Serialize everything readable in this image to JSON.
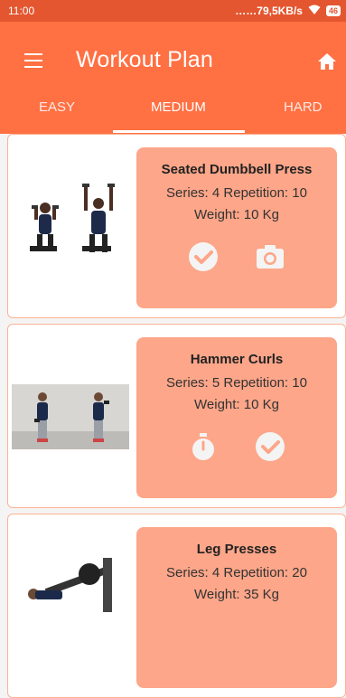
{
  "status": {
    "time": "11:00",
    "network": "……79,5KB/s",
    "battery": "46"
  },
  "appbar": {
    "title": "Workout Plan"
  },
  "tabs": [
    {
      "label": "EASY"
    },
    {
      "label": "MEDIUM",
      "selected": true
    },
    {
      "label": "HARD"
    }
  ],
  "exercises": [
    {
      "name": "Seated Dumbbell Press",
      "series_rep": "Series: 4 Repetition: 10",
      "weight": "Weight: 10 Kg",
      "actions": [
        "check-icon",
        "camera-icon"
      ]
    },
    {
      "name": "Hammer Curls",
      "series_rep": "Series: 5 Repetition: 10",
      "weight": "Weight: 10 Kg",
      "actions": [
        "stopwatch-icon",
        "check-icon"
      ]
    },
    {
      "name": "Leg Presses",
      "series_rep": "Series: 4 Repetition: 20",
      "weight": "Weight: 35 Kg"
    }
  ],
  "colors": {
    "statusbar": "#e4562f",
    "appbar": "#ff7043",
    "card": "#fda689",
    "icon": "#f4f4f4"
  }
}
